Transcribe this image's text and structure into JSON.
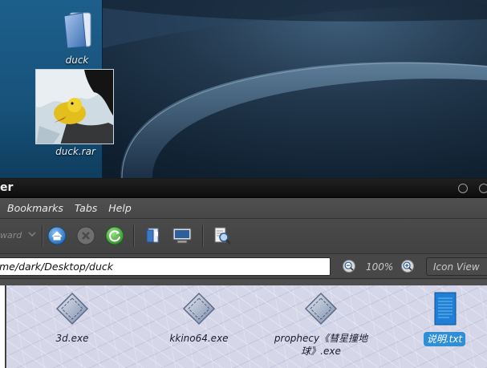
{
  "desktop": {
    "icons": [
      {
        "label": "duck",
        "icon": "folder-icon"
      },
      {
        "label": "duck.rar",
        "icon": "image-thumbnail"
      }
    ]
  },
  "window": {
    "title": "er",
    "menu": [
      "Bookmarks",
      "Tabs",
      "Help"
    ],
    "toolbar": {
      "forward_label": "ward",
      "icons": [
        "chevron-down-icon",
        "home-icon",
        "stop-icon",
        "reload-icon",
        "bookmark-page-icon",
        "computer-icon",
        "search-icon"
      ]
    },
    "location": {
      "path": "me/dark/Desktop/duck"
    },
    "zoom": "100%",
    "view": "Icon View"
  },
  "files": [
    {
      "name": "3d.exe",
      "icon": "executable-icon",
      "selected": false
    },
    {
      "name": "kkino64.exe",
      "icon": "executable-icon",
      "selected": false
    },
    {
      "name": "prophecy《彗星撞地球》.exe",
      "icon": "executable-icon",
      "selected": false
    },
    {
      "name": "说明.txt",
      "icon": "text-file-icon",
      "selected": true
    }
  ],
  "colors": {
    "selection": "#2e8fd6",
    "desktop_panel": "#1d5f8c",
    "window_bg": "#4e4e4e"
  }
}
